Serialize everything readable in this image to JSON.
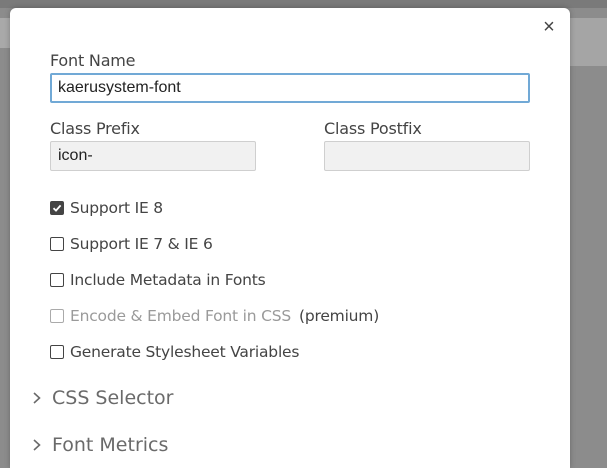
{
  "dialog": {
    "close_glyph": "×",
    "font_name": {
      "label": "Font Name",
      "value": "kaerusystem-font"
    },
    "class_prefix": {
      "label": "Class Prefix",
      "value": "icon-"
    },
    "class_postfix": {
      "label": "Class Postfix",
      "value": ""
    },
    "options": [
      {
        "label": "Support IE 8",
        "checked": true
      },
      {
        "label": "Support IE 7 & IE 6",
        "checked": false
      },
      {
        "label": "Include Metadata in Fonts",
        "checked": false
      },
      {
        "label": "Encode & Embed Font in CSS",
        "checked": false,
        "disabled": true,
        "suffix": "(premium)"
      },
      {
        "label": "Generate Stylesheet Variables",
        "checked": false
      }
    ],
    "sections": [
      {
        "label": "CSS Selector"
      },
      {
        "label": "Font Metrics"
      }
    ]
  }
}
